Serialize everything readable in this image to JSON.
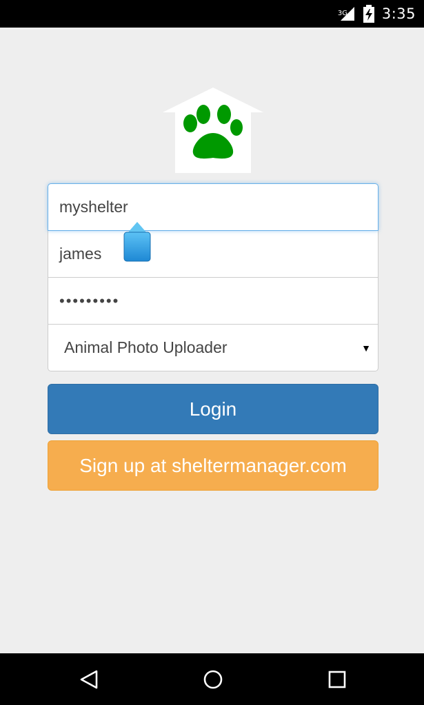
{
  "status_bar": {
    "network": "3G",
    "time": "3:35"
  },
  "logo": {
    "icon": "paw-house-icon",
    "house_color": "#ffffff",
    "paw_color": "#009900"
  },
  "login_form": {
    "shelter_value": "myshelter",
    "username_value": "james",
    "password_value": "•••••••••",
    "app_select_value": "Animal Photo Uploader"
  },
  "buttons": {
    "login_label": "Login",
    "signup_label": "Sign up at sheltermanager.com"
  },
  "colors": {
    "background": "#eeeeee",
    "login_button": "#337ab7",
    "signup_button": "#f6ad4e",
    "focus_border": "#66afe9",
    "text_handle": "#1e88d4"
  },
  "nav_bar": {
    "back_icon": "back-triangle-icon",
    "home_icon": "home-circle-icon",
    "recents_icon": "recents-square-icon"
  }
}
